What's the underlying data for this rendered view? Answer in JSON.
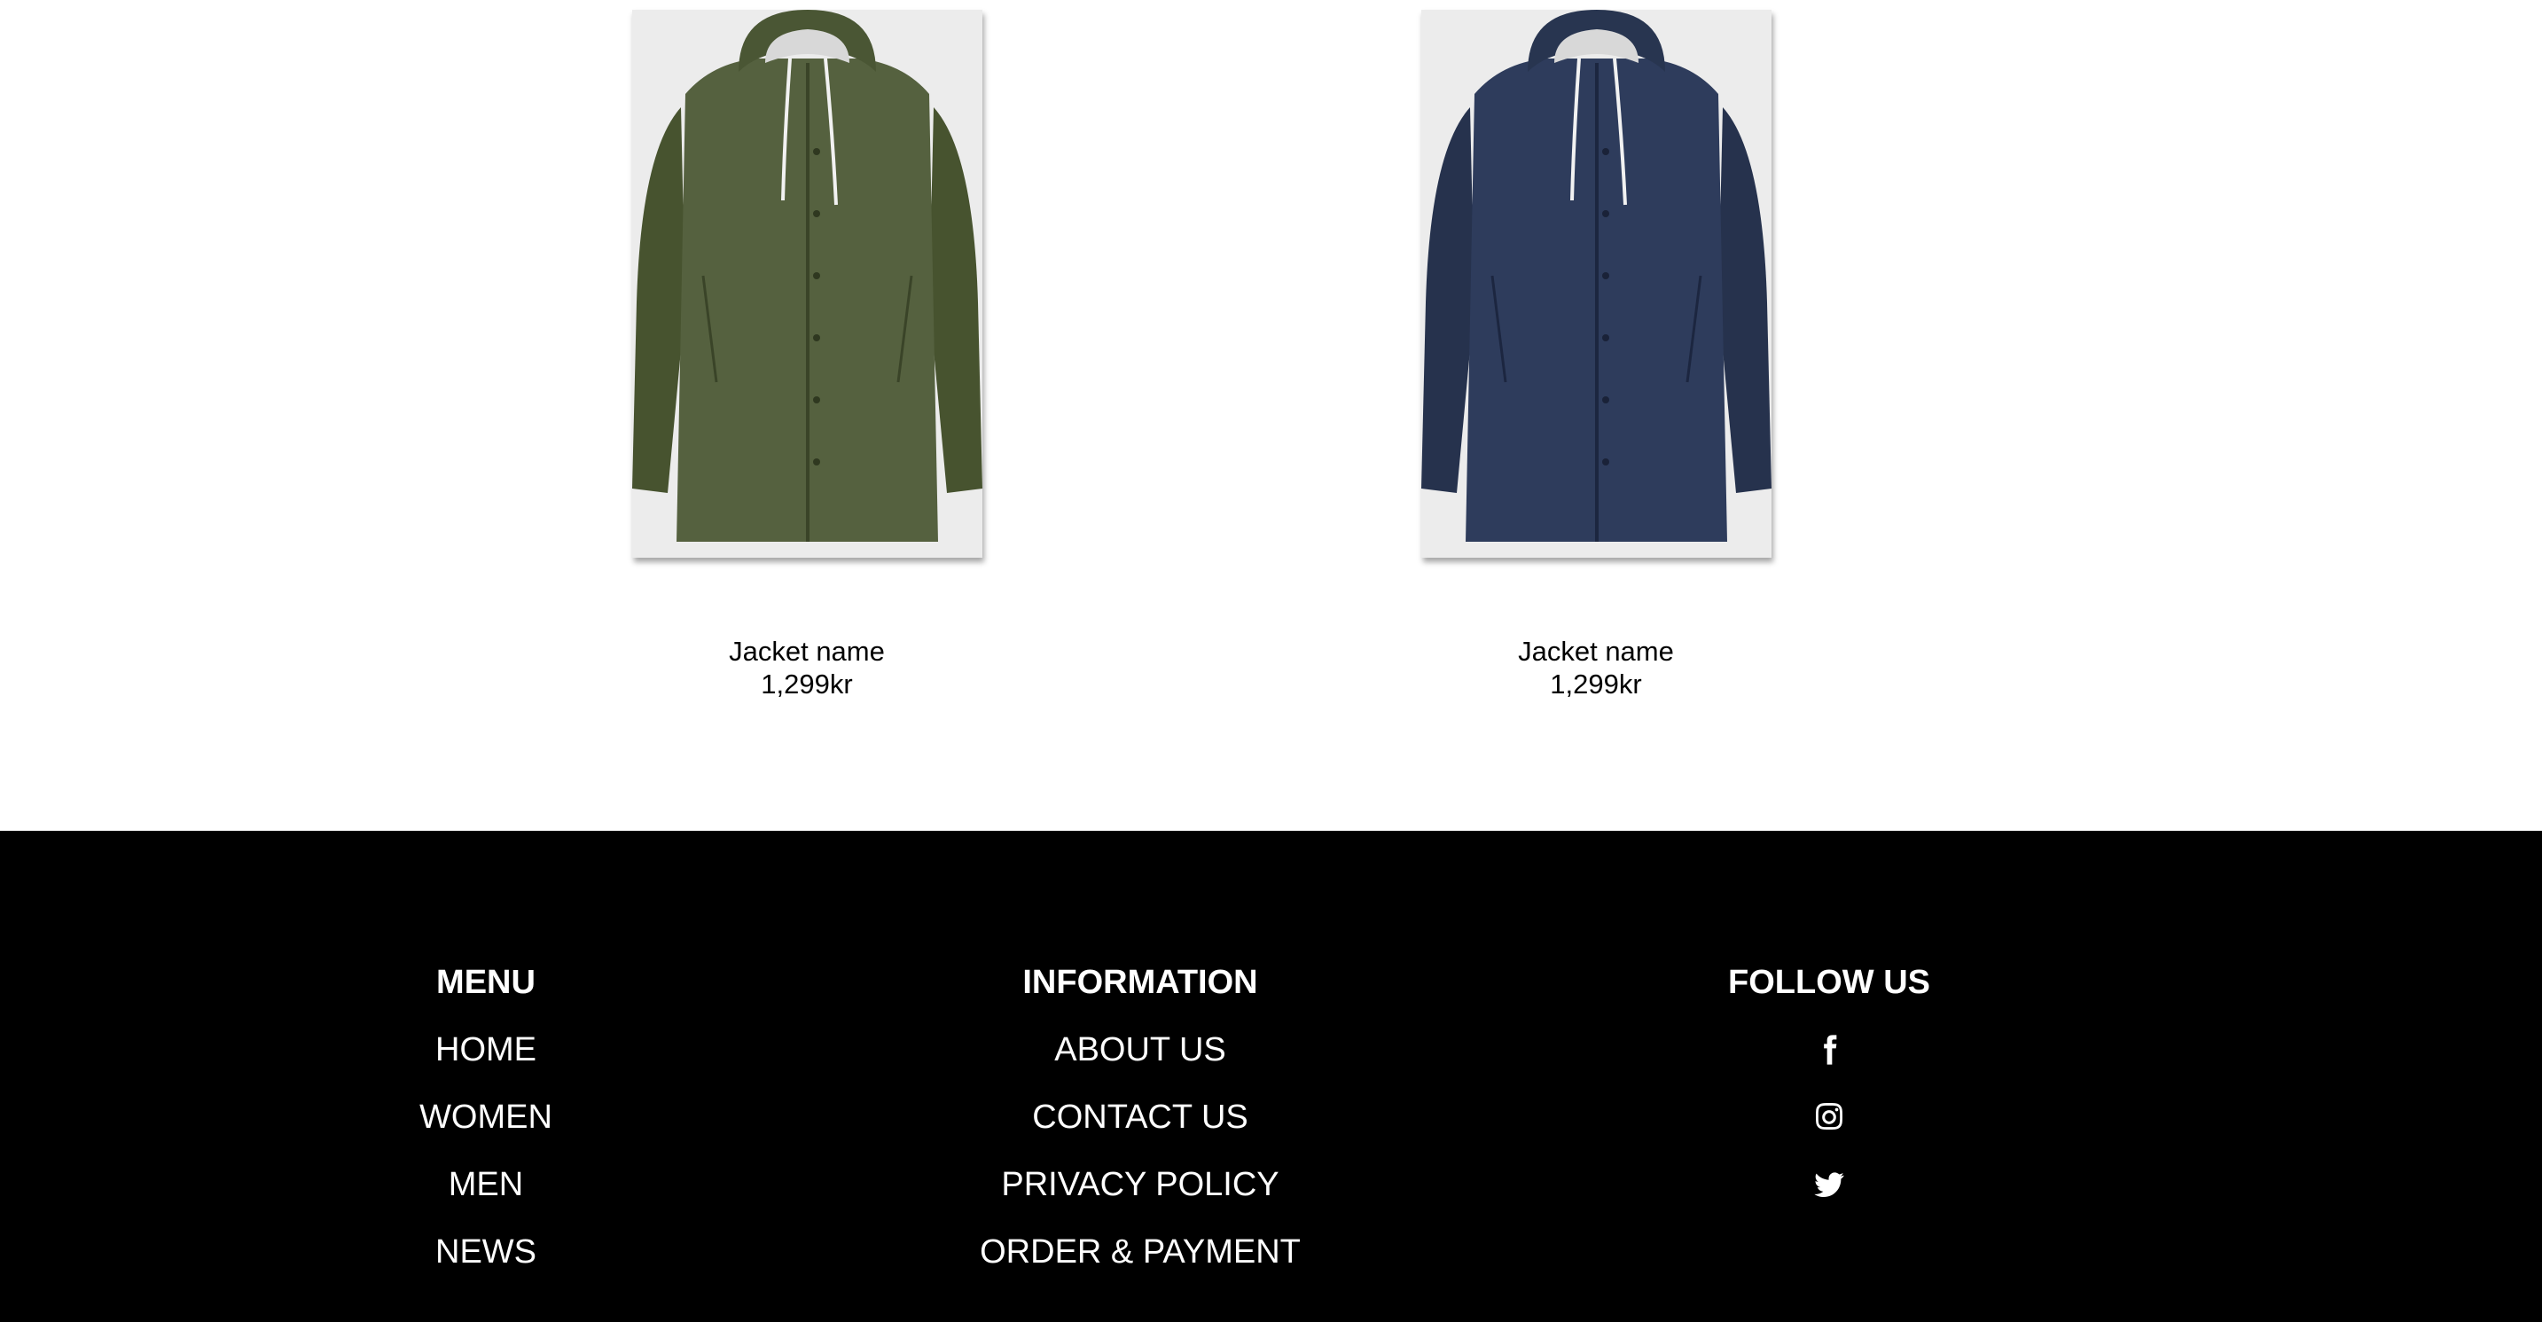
{
  "products": [
    {
      "name": "Jacket name",
      "price": "1,299kr",
      "color": "#4e5a3c"
    },
    {
      "name": "Jacket name",
      "price": "1,299kr",
      "color": "#2c3a58"
    }
  ],
  "footer": {
    "menu": {
      "heading": "MENU",
      "links": [
        "HOME",
        "WOMEN",
        "MEN",
        "NEWS"
      ]
    },
    "information": {
      "heading": "INFORMATION",
      "links": [
        "ABOUT US",
        "CONTACT US",
        "PRIVACY POLICY",
        "ORDER & PAYMENT"
      ]
    },
    "follow": {
      "heading": "FOLLOW US",
      "icons": [
        "facebook-icon",
        "instagram-icon",
        "twitter-icon"
      ]
    }
  }
}
